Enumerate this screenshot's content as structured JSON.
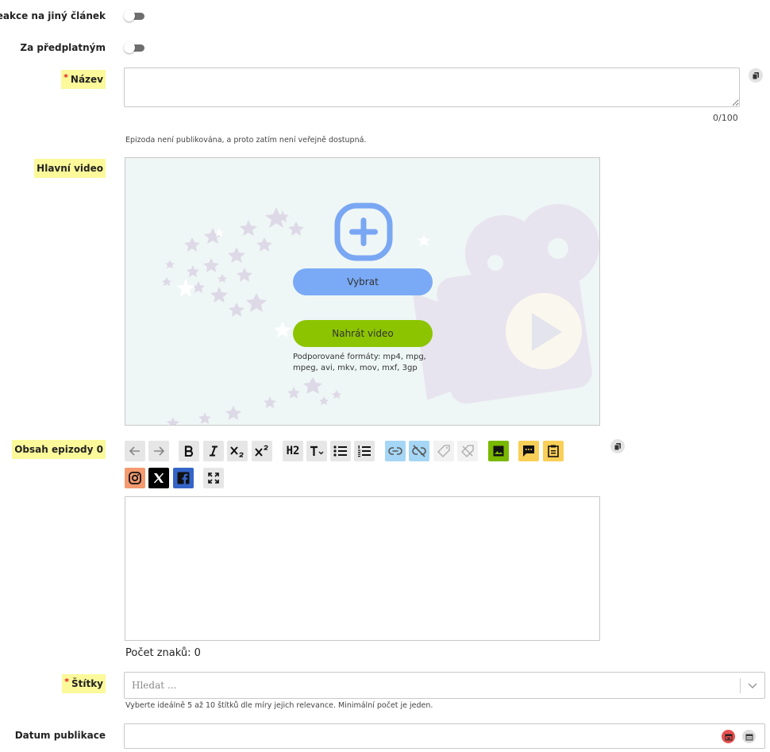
{
  "form": {
    "reply_label": "Reakce na jiný článek",
    "subscription_label": "Za předplatným",
    "title": {
      "required_mark": "*",
      "label": "Název",
      "counter": "0/100",
      "hint": "Epizoda není publikována, a proto zatím není veřejně dostupná."
    },
    "video": {
      "label": "Hlavní video",
      "select_label": "Vybrat",
      "upload_label": "Nahrát video",
      "formats": "Podporované formáty: mp4, mpg, mpeg, avi, mkv, mov, mxf, 3gp"
    },
    "content": {
      "label": "Obsah epizody 0",
      "char_count": "Počet znaků: 0",
      "heading_label": "H2"
    },
    "tags": {
      "required_mark": "*",
      "label": "Štítky",
      "placeholder": "Hledat ...",
      "hint": "Vyberte ideálně 5 až 10 štítků dle míry jejich relevance. Minimální počet je jeden."
    },
    "publish_date": {
      "label": "Datum publikace"
    }
  },
  "colors": {
    "highlight": "#fbf99a",
    "select_button": "#7aaaf6",
    "upload_button": "#8cc400",
    "link_tools": "#a6d6f5",
    "image_tool": "#7ab800",
    "yellow_tools": "#f9cf57",
    "instagram": "#f49a6e",
    "x": "#000000",
    "facebook": "#3565c8",
    "required": "#e02020"
  }
}
